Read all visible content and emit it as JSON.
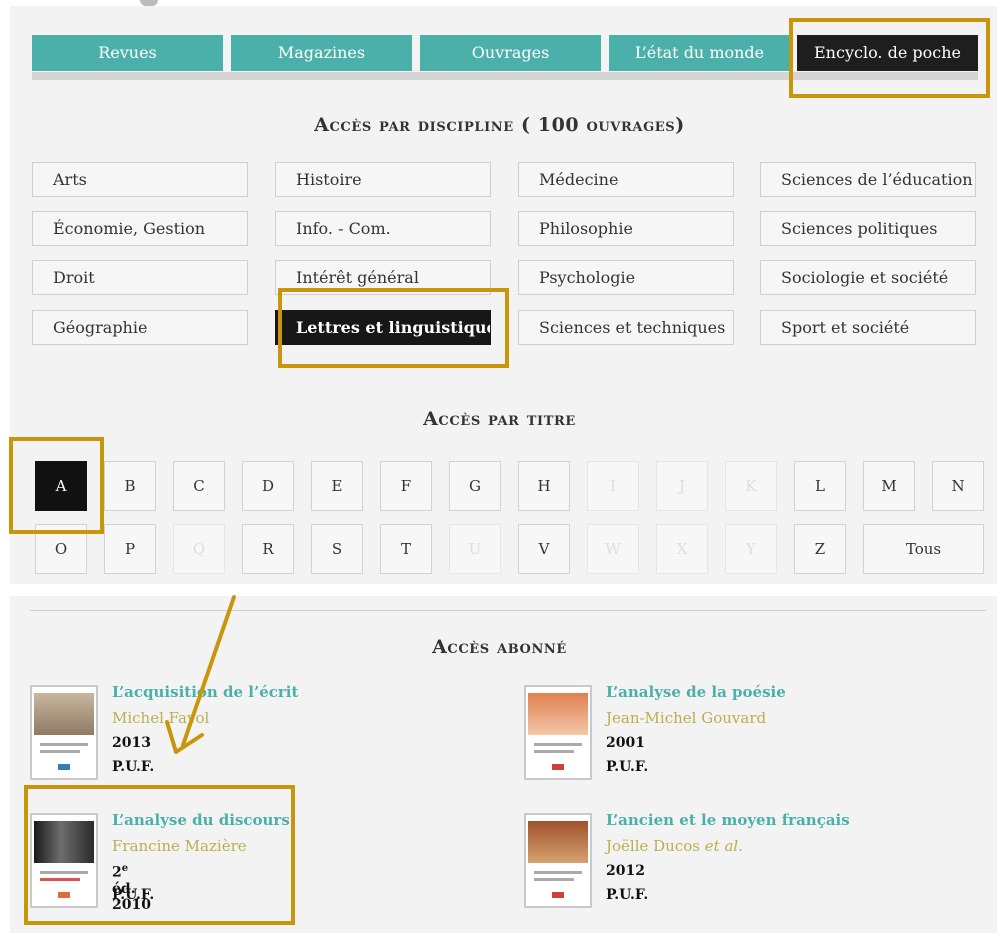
{
  "tabs": [
    {
      "label": "Revues"
    },
    {
      "label": "Magazines"
    },
    {
      "label": "Ouvrages"
    },
    {
      "label": "L’état du monde"
    },
    {
      "label": "Encyclo. de poche"
    }
  ],
  "discipline_heading": "Accès par discipline ( 100 ouvrages)",
  "disciplines": [
    "Arts",
    "Histoire",
    "Médecine",
    "Sciences de l’éducation",
    "Économie, Gestion",
    "Info. - Com.",
    "Philosophie",
    "Sciences politiques",
    "Droit",
    "Intérêt général",
    "Psychologie",
    "Sociologie et société",
    "Géographie",
    "Lettres et linguistique",
    "Sciences et techniques",
    "Sport et société"
  ],
  "title_heading": "Accès par titre",
  "letters": {
    "row1": [
      "A",
      "B",
      "C",
      "D",
      "E",
      "F",
      "G",
      "H",
      "I",
      "J",
      "K",
      "L",
      "M",
      "N"
    ],
    "row2": [
      "O",
      "P",
      "Q",
      "R",
      "S",
      "T",
      "U",
      "V",
      "W",
      "X",
      "Y",
      "Z"
    ],
    "all_label": "Tous",
    "disabled": [
      "I",
      "J",
      "K",
      "Q",
      "U",
      "W",
      "X",
      "Y"
    ],
    "active": "A"
  },
  "subscriber_heading": "Accès abonné",
  "books": [
    {
      "title": "L’acquisition de l’écrit",
      "author": "Michel Fayol",
      "year": "2013",
      "publisher": "P.U.F."
    },
    {
      "title": "L’analyse de la poésie",
      "author": "Jean-Michel Gouvard",
      "year": "2001",
      "publisher": "P.U.F."
    },
    {
      "title": "L’analyse du discours",
      "author": "Francine Mazière",
      "edition_num": "2",
      "edition_sup": "e",
      "edition_rest": " éd. 2010",
      "publisher": "P.U.F."
    },
    {
      "title": "L’ancien et le moyen français",
      "author": "Joëlle Ducos",
      "author_etal": "et al.",
      "year": "2012",
      "publisher": "P.U.F."
    }
  ],
  "colors": {
    "teal": "#4bb0a9",
    "dark": "#1e1e1e",
    "highlight": "#c8960d",
    "author": "#b9b04c"
  }
}
